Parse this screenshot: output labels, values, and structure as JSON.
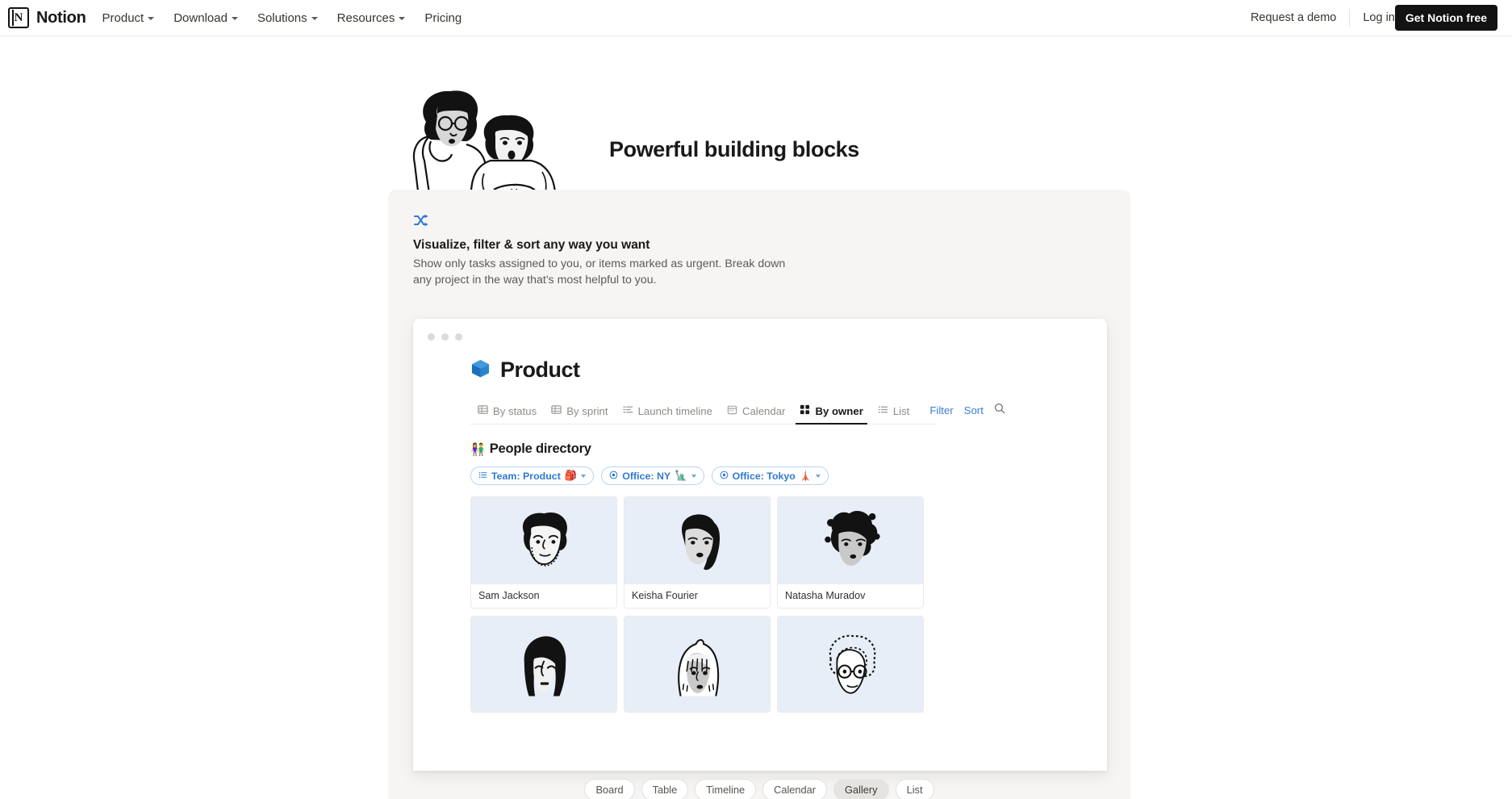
{
  "nav": {
    "brand": "Notion",
    "brand_icon": "notion-logo-icon",
    "links": [
      {
        "label": "Product",
        "has_caret": true
      },
      {
        "label": "Download",
        "has_caret": true
      },
      {
        "label": "Solutions",
        "has_caret": true
      },
      {
        "label": "Resources",
        "has_caret": true
      },
      {
        "label": "Pricing",
        "has_caret": false
      }
    ],
    "request_demo": "Request a demo",
    "log_in": "Log in",
    "cta": "Get Notion free"
  },
  "hero": {
    "title": "Powerful building blocks"
  },
  "panel": {
    "icon": "shuffle-icon",
    "icon_color": "#2f7ad1",
    "heading": "Visualize, filter & sort any way you want",
    "paragraph": "Show only tasks assigned to you, or items marked as urgent. Break down any project in the way that's most helpful to you."
  },
  "app": {
    "doc_icon": "blue-package-icon",
    "doc_title": "Product",
    "tabs": [
      {
        "label": "By status",
        "icon": "table-grid-icon",
        "active": false
      },
      {
        "label": "By sprint",
        "icon": "table-grid-icon",
        "active": false
      },
      {
        "label": "Launch timeline",
        "icon": "timeline-icon",
        "active": false
      },
      {
        "label": "Calendar",
        "icon": "calendar-icon",
        "active": false
      },
      {
        "label": "By owner",
        "icon": "gallery-grid-icon",
        "active": true
      },
      {
        "label": "List",
        "icon": "list-icon",
        "active": false
      }
    ],
    "actions": [
      {
        "label": "Filter",
        "name": "filter-button"
      },
      {
        "label": "Sort",
        "name": "sort-button"
      }
    ],
    "search_icon": "search-icon",
    "database": {
      "emoji": "👫",
      "title": "People directory",
      "filters": [
        {
          "label": "Team: Product",
          "emoji": "🎒",
          "icon": "list-icon"
        },
        {
          "label": "Office: NY",
          "emoji": "🗽",
          "icon": "select-circle-icon"
        },
        {
          "label": "Office: Tokyo",
          "emoji": "🗼",
          "icon": "select-circle-icon"
        }
      ],
      "cards_row1": [
        {
          "name": "Sam Jackson",
          "avatar": "avatar-curly-hair-glasses"
        },
        {
          "name": "Keisha Fourier",
          "avatar": "avatar-long-dark-hair"
        },
        {
          "name": "Natasha Muradov",
          "avatar": "avatar-spiky-hair"
        }
      ],
      "cards_row2": [
        {
          "name": "",
          "avatar": "avatar-bob-haircut"
        },
        {
          "name": "",
          "avatar": "avatar-bangs"
        },
        {
          "name": "",
          "avatar": "avatar-afro-glasses"
        }
      ],
      "card_bg": "#e7eef8"
    }
  },
  "switcher": {
    "options": [
      {
        "label": "Board",
        "active": false
      },
      {
        "label": "Table",
        "active": false
      },
      {
        "label": "Timeline",
        "active": false
      },
      {
        "label": "Calendar",
        "active": false
      },
      {
        "label": "Gallery",
        "active": true
      },
      {
        "label": "List",
        "active": false
      }
    ]
  }
}
